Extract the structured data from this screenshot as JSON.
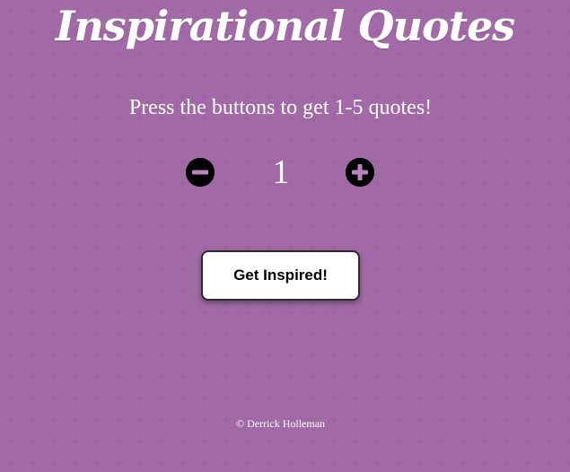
{
  "app": {
    "title": "Inspirational Quotes",
    "subtitle": "Press the buttons to get 1-5 quotes!"
  },
  "counter": {
    "value": "1",
    "decrement_icon": "minus-circle-icon",
    "increment_icon": "plus-circle-icon"
  },
  "actions": {
    "inspire_label": "Get Inspired!"
  },
  "footer": {
    "copyright": "© Derrick Holleman"
  },
  "colors": {
    "background": "#bb82bd",
    "pattern": "#a064a5",
    "text": "#ffffff",
    "button_bg": "#ffffff",
    "icon": "#000000"
  }
}
